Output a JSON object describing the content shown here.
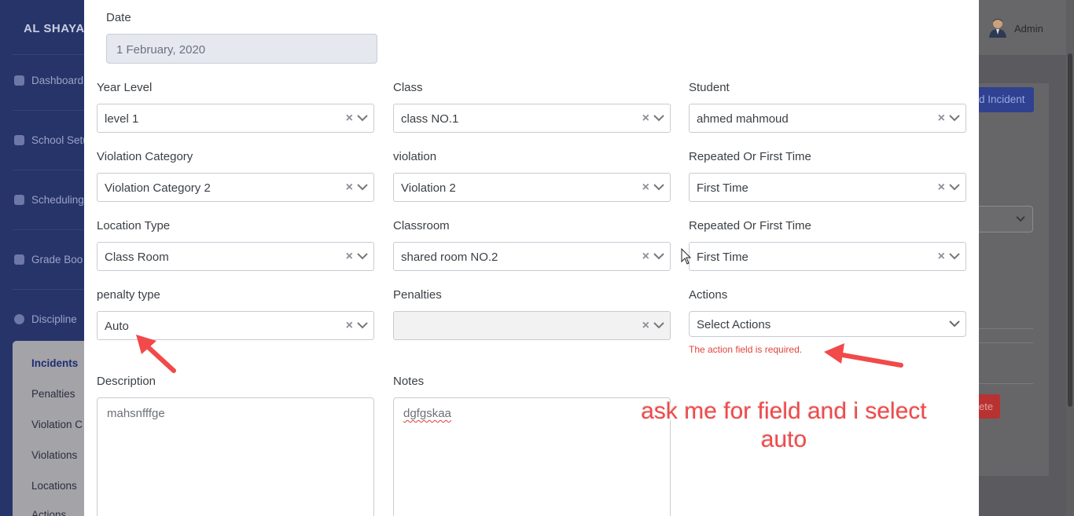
{
  "app": {
    "brand": "AL SHAYA",
    "user": "Admin",
    "sidebar": {
      "items": [
        "Dashboard",
        "School Setu",
        "Scheduling",
        "Grade Boo",
        "Discipline"
      ],
      "submenu": [
        "Incidents",
        "Penalties",
        "Violation C",
        "Violations",
        "Locations",
        "Actions"
      ]
    },
    "background": {
      "add_button": "d Incident",
      "delete_button": "ete"
    }
  },
  "form": {
    "date": {
      "label": "Date",
      "value": "1 February, 2020"
    },
    "year_level": {
      "label": "Year Level",
      "value": "level 1"
    },
    "class": {
      "label": "Class",
      "value": "class NO.1"
    },
    "student": {
      "label": "Student",
      "value": "ahmed mahmoud"
    },
    "violation_category": {
      "label": "Violation Category",
      "value": "Violation Category 2"
    },
    "violation": {
      "label": "violation",
      "value": "Violation 2"
    },
    "repeated_1": {
      "label": "Repeated Or First Time",
      "value": "First Time"
    },
    "location_type": {
      "label": "Location Type",
      "value": "Class Room"
    },
    "classroom": {
      "label": "Classroom",
      "value": "shared room NO.2"
    },
    "repeated_2": {
      "label": "Repeated Or First Time",
      "value": "First Time"
    },
    "penalty_type": {
      "label": "penalty type",
      "value": "Auto"
    },
    "penalties": {
      "label": "Penalties",
      "value": ""
    },
    "actions": {
      "label": "Actions",
      "placeholder": "Select Actions",
      "error": "The action field is required."
    },
    "description": {
      "label": "Description",
      "value": "mahsnfffge"
    },
    "notes": {
      "label": "Notes",
      "value": "dgfgskaa"
    }
  },
  "annotation": {
    "text": "ask me for field and i select auto",
    "color": "#f24949"
  },
  "icons": [
    "clear-x-icon",
    "chevron-down-icon",
    "user-avatar-icon",
    "mouse-cursor-icon",
    "red-arrow-icon"
  ]
}
